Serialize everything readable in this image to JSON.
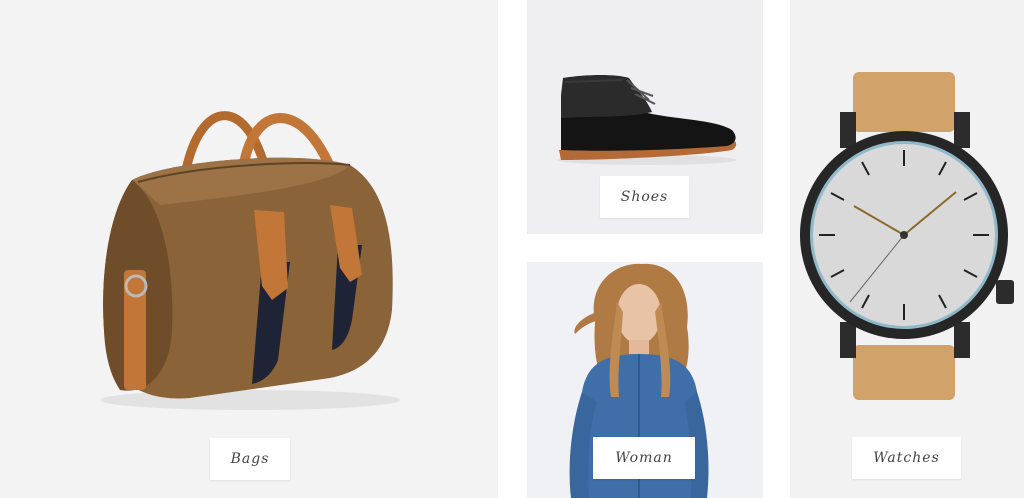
{
  "categories": {
    "bags": {
      "label": "Bags",
      "image": "brown-duffel-bag"
    },
    "shoes": {
      "label": "Shoes",
      "image": "black-chukka-boot"
    },
    "woman": {
      "label": "Woman",
      "image": "woman-denim-shirt"
    },
    "watches": {
      "label": "Watches",
      "image": "komono-wrist-watch"
    }
  },
  "colors": {
    "tile_background": "#f1f1f1",
    "button_background": "#ffffff",
    "button_text": "#444444"
  }
}
